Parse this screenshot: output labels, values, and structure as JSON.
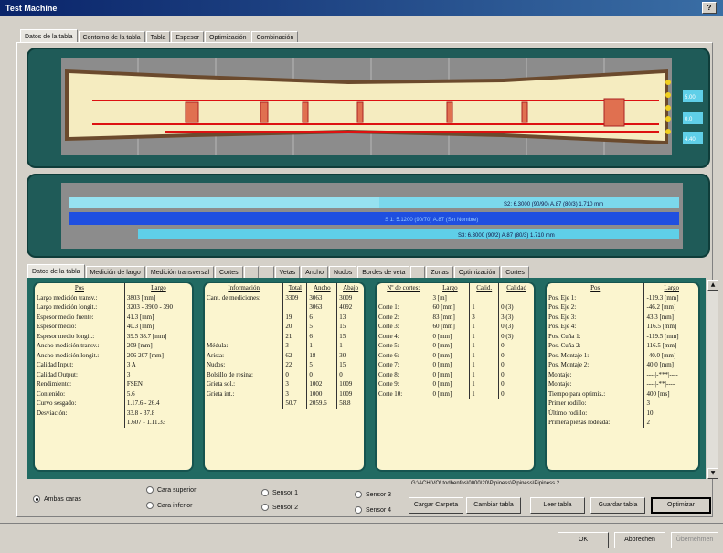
{
  "window": {
    "title": "Test Machine",
    "help": "?"
  },
  "main_tabs": [
    "Datos de la tabla",
    "Contorno de la tabla",
    "Tabla",
    "Espesor",
    "Optimización",
    "Combinación"
  ],
  "sub_tabs": [
    "Datos de la tabla",
    "Medición de largo",
    "Medición transversal",
    "Cortes",
    "",
    "",
    "Vetas",
    "Ancho",
    "Nudos",
    "Bordes de veta",
    "",
    "Zonas",
    "Optimización",
    "Cortes"
  ],
  "top_panel": {
    "right_values": [
      "5.00",
      "0.0",
      "4.40"
    ]
  },
  "mid_panel": {
    "bar_labels": [
      "S2: 6.3000 (90/90) A.87 (80/3) 1.710 mm",
      "S 1: 5.1200 (90/70) A.87 (Sin Nombre)",
      "S3: 6.3000 (90/2) A.87 (80/3) 1.710 mm"
    ]
  },
  "table1": {
    "headers": [
      "Pos",
      "Largo"
    ],
    "rows": [
      [
        "Largo medición transv.:",
        "3803 [mm]"
      ],
      [
        "Largo medición longit.:",
        "3203 - 3900 - 390"
      ],
      [
        "Espesor medio fuente:",
        "41.3 [mm]"
      ],
      [
        "Espesor medio:",
        "40.3 [mm]"
      ],
      [
        "Espesor medio longit.:",
        "39.5  38.7  [mm]"
      ],
      [
        "Ancho medición transv.:",
        "209 [mm]"
      ],
      [
        "Ancho medición longit.:",
        "206  207 [mm]"
      ],
      [
        "Calidad Input:",
        "3  A"
      ],
      [
        "Calidad Output:",
        "3"
      ],
      [
        "Rendimiento:",
        "FSEN"
      ],
      [
        "Contenido:",
        "5.6"
      ],
      [
        "Curvo sesgado:",
        "1.17.6 - 26.4"
      ],
      [
        "Desviación:",
        "33.8 - 37.8"
      ],
      [
        "",
        "1.607 - 1.11.33"
      ]
    ]
  },
  "table2": {
    "headers": [
      "Información",
      "Total",
      "Ancho",
      "Abajo"
    ],
    "rows": [
      [
        "Cant. de mediciones:",
        "3309",
        "3063",
        "3009"
      ],
      [
        "",
        "",
        "3063",
        "4092"
      ],
      [
        "",
        "19",
        "6",
        "13"
      ],
      [
        "",
        "20",
        "5",
        "15"
      ],
      [
        "",
        "21",
        "6",
        "15"
      ],
      [
        "Médula:",
        "3",
        "1",
        "1"
      ],
      [
        "Arista:",
        "62",
        "18",
        "30"
      ],
      [
        "Nudos:",
        "22",
        "5",
        "15"
      ],
      [
        "Bolsillo de resina:",
        "0",
        "0",
        "0"
      ],
      [
        "Grieta sol.:",
        "3",
        "1002",
        "1009"
      ],
      [
        "Grieta int.:",
        "3",
        "1000",
        "1009"
      ],
      [
        "",
        "50.7",
        "2059.6",
        "58.8"
      ]
    ]
  },
  "table3": {
    "headers": [
      "Nº de cortes:",
      "Largo",
      "Calid.",
      "Calidad"
    ],
    "rows": [
      [
        "",
        "3 [m]",
        "",
        ""
      ],
      [
        "Corte 1:",
        "60 [mm]",
        "1",
        "0 (3)"
      ],
      [
        "Corte 2:",
        "83 [mm]",
        "3",
        "3 (3)"
      ],
      [
        "Corte 3:",
        "60 [mm]",
        "1",
        "0 (3)"
      ],
      [
        "Corte 4:",
        "0 [mm]",
        "1",
        "0 (3)"
      ],
      [
        "Corte 5:",
        "0 [mm]",
        "1",
        "0"
      ],
      [
        "Corte 6:",
        "0 [mm]",
        "1",
        "0"
      ],
      [
        "Corte 7:",
        "0 [mm]",
        "1",
        "0"
      ],
      [
        "Corte 8:",
        "0 [mm]",
        "1",
        "0"
      ],
      [
        "Corte 9:",
        "0 [mm]",
        "1",
        "0"
      ],
      [
        "Corte 10:",
        "0 [mm]",
        "1",
        "0"
      ]
    ]
  },
  "table4": {
    "headers": [
      "Pos",
      "Largo"
    ],
    "rows": [
      [
        "Pos. Eje 1:",
        "-119.3 [mm]"
      ],
      [
        "Pos. Eje 2:",
        "-46.2 [mm]"
      ],
      [
        "Pos. Eje 3:",
        "43.3 [mm]"
      ],
      [
        "Pos. Eje 4:",
        "116.5 [mm]"
      ],
      [
        "Pos. Cuña 1:",
        "-119.5 [mm]"
      ],
      [
        "Pos. Cuña 2:",
        "116.5 [mm]"
      ],
      [
        "Pos. Montaje 1:",
        "-40.0 [mm]"
      ],
      [
        "Pos. Montaje 2:",
        "40.0 [mm]"
      ],
      [
        "Montaje:",
        "----|-***|----"
      ],
      [
        "Montaje:",
        "----|-**|----"
      ],
      [
        "Tiempo para optimiz.:",
        "400 [ms]"
      ],
      [
        "Primer rodillo:",
        "3"
      ],
      [
        "Último rodillo:",
        "10"
      ],
      [
        "Primera piezas rodeada:",
        "2"
      ]
    ]
  },
  "bottom": {
    "radio_group1": [
      "Ambas caras"
    ],
    "radio_group2": [
      "Cara superior",
      "Cara inferior"
    ],
    "radio_group3": [
      "Sensor 1",
      "Sensor 2"
    ],
    "radio_group4": [
      "Sensor 3",
      "Sensor 4"
    ],
    "path": "G:\\ACHIVO\\ todbenfos\\0000\\20\\Pipiness\\Pipiness\\Pipiness 2",
    "buttons": [
      "Cargar Carpeta",
      "Cambiar tabla",
      "Leer tabla",
      "Guardar tabla",
      "Optimizar"
    ]
  },
  "footer": {
    "buttons": [
      "OK",
      "Abbrechen",
      "Übernehmen"
    ]
  },
  "colors": {
    "panel": "#1f5b58",
    "board": "#f5ecc0",
    "bar_cyan": "#5fcfe8",
    "bar_blue": "#1f4fe0"
  }
}
